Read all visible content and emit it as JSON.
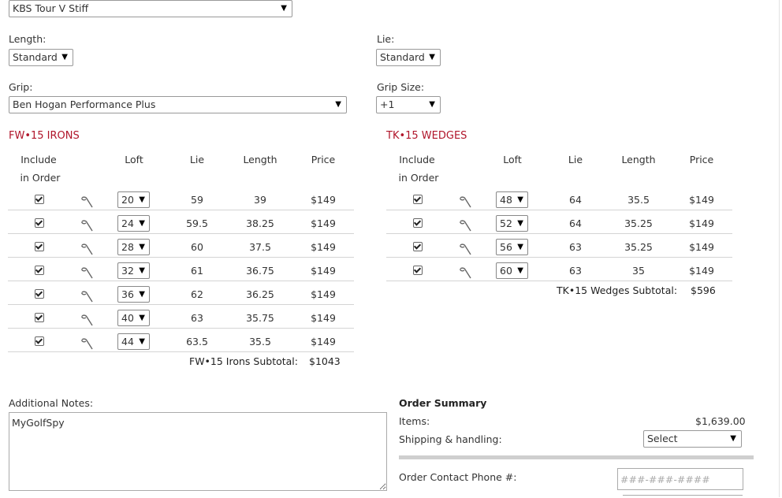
{
  "shaft": {
    "value": "KBS Tour V Stiff"
  },
  "length": {
    "label": "Length:",
    "value": "Standard"
  },
  "lie": {
    "label": "Lie:",
    "value": "Standard"
  },
  "grip": {
    "label": "Grip:",
    "value": "Ben Hogan Performance Plus"
  },
  "grip_size": {
    "label": "Grip Size:",
    "value": "+1"
  },
  "irons": {
    "title": "FW•15 IRONS",
    "headers": {
      "include_1": "Include",
      "include_2": "in Order",
      "loft": "Loft",
      "lie": "Lie",
      "length": "Length",
      "price": "Price"
    },
    "rows": [
      {
        "loft": "20",
        "lie": "59",
        "length": "39",
        "price": "$149"
      },
      {
        "loft": "24",
        "lie": "59.5",
        "length": "38.25",
        "price": "$149"
      },
      {
        "loft": "28",
        "lie": "60",
        "length": "37.5",
        "price": "$149"
      },
      {
        "loft": "32",
        "lie": "61",
        "length": "36.75",
        "price": "$149"
      },
      {
        "loft": "36",
        "lie": "62",
        "length": "36.25",
        "price": "$149"
      },
      {
        "loft": "40",
        "lie": "63",
        "length": "35.75",
        "price": "$149"
      },
      {
        "loft": "44",
        "lie": "63.5",
        "length": "35.5",
        "price": "$149"
      }
    ],
    "subtotal_label": "FW•15 Irons Subtotal:",
    "subtotal_value": "$1043"
  },
  "wedges": {
    "title": "TK•15 WEDGES",
    "headers": {
      "include_1": "Include",
      "include_2": "in Order",
      "loft": "Loft",
      "lie": "Lie",
      "length": "Length",
      "price": "Price"
    },
    "rows": [
      {
        "loft": "48",
        "lie": "64",
        "length": "35.5",
        "price": "$149"
      },
      {
        "loft": "52",
        "lie": "64",
        "length": "35.25",
        "price": "$149"
      },
      {
        "loft": "56",
        "lie": "63",
        "length": "35.25",
        "price": "$149"
      },
      {
        "loft": "60",
        "lie": "63",
        "length": "35",
        "price": "$149"
      }
    ],
    "subtotal_label": "TK•15 Wedges Subtotal:",
    "subtotal_value": "$596"
  },
  "notes": {
    "label": "Additional Notes:",
    "value": "MyGolfSpy"
  },
  "summary": {
    "title": "Order Summary",
    "items_label": "Items:",
    "items_value": "$1,639.00",
    "shipping_label": "Shipping & handling:",
    "shipping_value": "Select",
    "phone_label": "Order Contact Phone #:",
    "phone_placeholder": "###-###-####"
  },
  "colors": {
    "accent": "#b0152a"
  }
}
